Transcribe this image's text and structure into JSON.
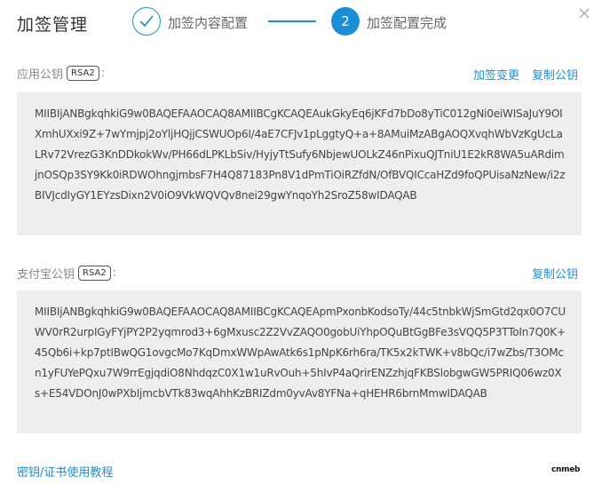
{
  "header": {
    "title": "加签管理",
    "step1_label": "加签内容配置",
    "step2_number": "2",
    "step2_label": "加签配置完成"
  },
  "app_key": {
    "label": "应用公钥",
    "tag": "RSA2",
    "colon": ":",
    "change_link": "加签变更",
    "copy_link": "复制公钥",
    "value": "MIIBIjANBgkqhkiG9w0BAQEFAAOCAQ8AMIIBCgKCAQEAukGkyEq6jKFd7bDo8yTiC012gNi0eiWISaJuY9OIXmhUXxi9Z+7wYmjpj2oYljHQjjCSWUOp6I/4aE7CFJv1pLggtyQ+a+8AMuiMzABgAOQXvqhWbVzKgUcLaLRv72VrezG3KnDDkokWv/PH66dLPKLbSiv/HyjyTtSufy6NbjewUOLkZ46nPixuQJTniU1E2kR8WA5uARdimjnOSQp3SY9Kk0iRDWOhngjmbsF7H4Q87183Pn8V1dPmTiOiRZfdN/OfBVQICcaHZd9foQPUisaNzNew/i2zBIVJcdIyGY1EYzsDixn2V0iO9VkWQVQv8nei29gwYnqoYh2SroZ58wIDAQAB"
  },
  "alipay_key": {
    "label": "支付宝公钥",
    "tag": "RSA2",
    "colon": ":",
    "copy_link": "复制公钥",
    "value": "MIIBIjANBgkqhkiG9w0BAQEFAAOCAQ8AMIIBCgKCAQEApmPxonbKodsoTy/44c5tnbkWjSmGtd2qx0O7CUWV0rR2urpIGyFYjPY2P2yqmrod3+6gMxusc2Z2VvZAQO0gobUiYhpOQuBtGgBFe3sVQQ5P3TToIn7Q0K+45Qb6i+kp7ptIBwQG1ovgcMo7KqDmxWWpAwAtk6s1pNpK6rh6ra/TK5x2kTWK+v8bQc/i7wZbs/T3OMcn1yFUYePQxu7W9rrEgjqdiO8NhdqzC0X1w1uRvOuh+5hIvP4aQrirENZzhjqFKBSlobgwGW5PRIQ06wz0Xs+E54VDOnJ0wPXbIjmcbVTk83wqAhhKzBRIZdm0yvAv8YFNa+qHEHR6brnMmwIDAQAB"
  },
  "footer": {
    "help_link": "密钥/证书使用教程",
    "logo_text": "cnmeb"
  },
  "colors": {
    "accent": "#1a8fd7",
    "keybox_bg": "#eeeeef"
  }
}
